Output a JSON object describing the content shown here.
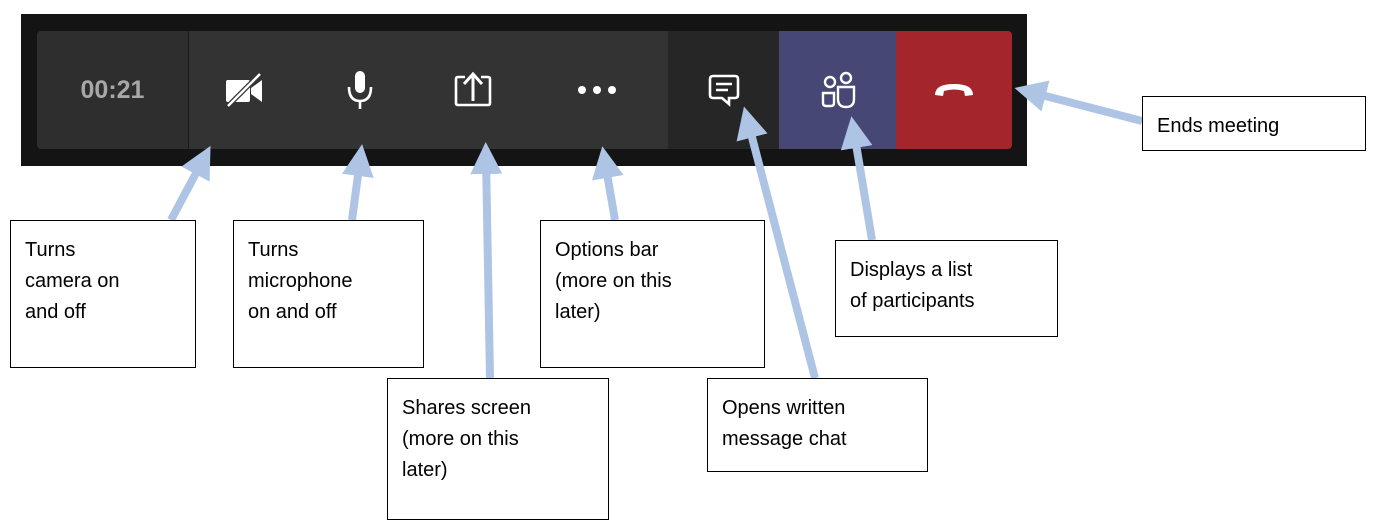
{
  "toolbar": {
    "timer": "00:21",
    "buttons": [
      {
        "name": "camera-off-icon"
      },
      {
        "name": "microphone-icon"
      },
      {
        "name": "share-screen-icon"
      },
      {
        "name": "more-options-icon"
      },
      {
        "name": "chat-icon"
      },
      {
        "name": "participants-icon"
      },
      {
        "name": "hang-up-icon"
      }
    ],
    "colors": {
      "bar": "#333333",
      "timer_bg": "#2e2e2e",
      "chat_bg": "#262626",
      "participants_bg": "#464775",
      "hangup_bg": "#a4262c",
      "arrow": "#aec4e5"
    }
  },
  "callouts": {
    "camera": "Turns\ncamera on\nand off",
    "microphone": "Turns\nmicrophone\non and off",
    "share": "Shares screen\n(more on this\nlater)",
    "options": "Options bar\n(more on this\nlater)",
    "chat": "Opens written\nmessage chat",
    "participants": "Displays a list\nof participants",
    "end": "Ends meeting"
  }
}
